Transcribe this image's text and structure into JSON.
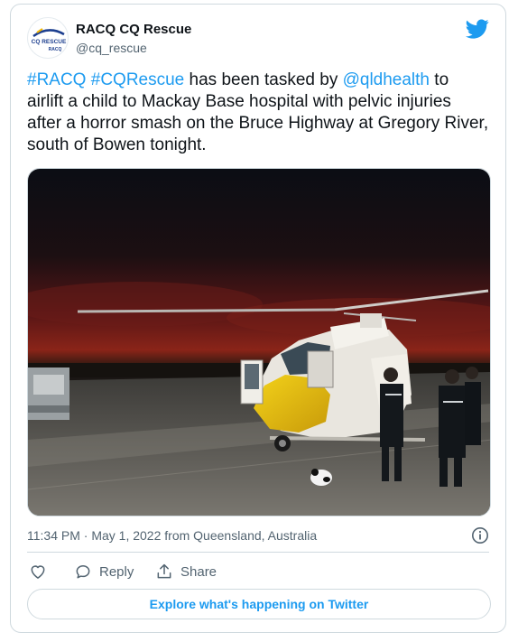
{
  "tweet": {
    "author": {
      "display_name": "RACQ CQ Rescue",
      "handle": "@cq_rescue",
      "avatar_text": "CQ RESCUE",
      "avatar_subtext": "RACQ"
    },
    "text_segments": [
      {
        "text": "#RACQ",
        "link": true
      },
      {
        "text": " ",
        "link": false
      },
      {
        "text": "#CQRescue",
        "link": true
      },
      {
        "text": " has been tasked by ",
        "link": false
      },
      {
        "text": "@qldhealth",
        "link": true
      },
      {
        "text": " to airlift a child to Mackay Base hospital with pelvic injuries after a horror smash on the Bruce Highway at Gregory River, south of Bowen tonight.",
        "link": false
      }
    ],
    "timestamp": "11:34 PM · May 1, 2022 from Queensland, Australia",
    "actions": {
      "reply_label": "Reply",
      "share_label": "Share"
    },
    "explore_label": "Explore what's happening on Twitter",
    "icons": {
      "brand": "twitter-bird-icon",
      "like": "heart-icon",
      "reply": "speech-bubble-icon",
      "share": "share-upload-icon",
      "info": "info-icon"
    },
    "colors": {
      "accent": "#1d9bf0",
      "text": "#0f1419",
      "muted": "#536471",
      "border": "#cfd9de"
    }
  }
}
